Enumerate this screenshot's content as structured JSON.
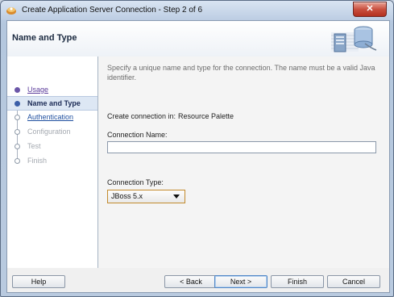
{
  "window": {
    "title": "Create Application Server Connection - Step 2 of 6",
    "close_label": "✕"
  },
  "header": {
    "title": "Name and Type"
  },
  "nav": {
    "items": [
      {
        "label": "Usage",
        "state": "done"
      },
      {
        "label": "Name and Type",
        "state": "active"
      },
      {
        "label": "Authentication",
        "state": "link"
      },
      {
        "label": "Configuration",
        "state": "disabled"
      },
      {
        "label": "Test",
        "state": "disabled"
      },
      {
        "label": "Finish",
        "state": "disabled"
      }
    ]
  },
  "form": {
    "description": "Specify a unique name and type for the connection. The name must be a valid Java identifier.",
    "create_in_label": "Create connection in:",
    "create_in_value": "Resource Palette",
    "name_label": "Connection Name:",
    "name_value": "",
    "type_label": "Connection Type:",
    "type_value": "JBoss 5.x"
  },
  "buttons": {
    "help": "Help",
    "back": "< Back",
    "next": "Next >",
    "finish": "Finish",
    "cancel": "Cancel"
  },
  "colors": {
    "accent": "#3b5ea8",
    "visited_link": "#5a3a9a",
    "link": "#1f4f9f",
    "disabled_text": "#a4a9b0",
    "close_button": "#c9503f"
  }
}
